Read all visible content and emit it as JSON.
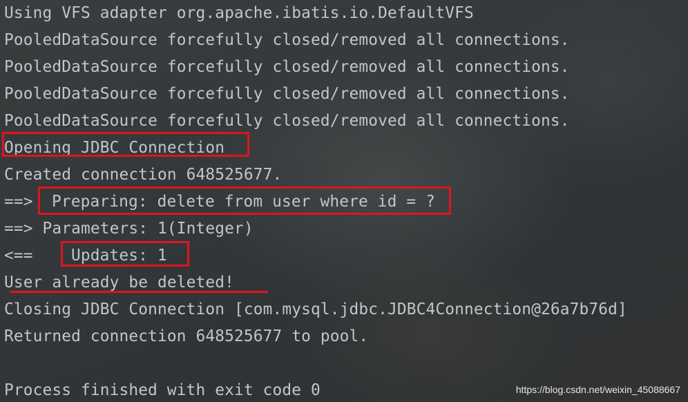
{
  "console": {
    "lines": [
      "Using VFS adapter org.apache.ibatis.io.DefaultVFS",
      "PooledDataSource forcefully closed/removed all connections.",
      "PooledDataSource forcefully closed/removed all connections.",
      "PooledDataSource forcefully closed/removed all connections.",
      "PooledDataSource forcefully closed/removed all connections.",
      "Opening JDBC Connection",
      "Created connection 648525677.",
      "==>",
      "==> Parameters: 1(Integer)",
      "<==",
      "User already be deleted!",
      "Closing JDBC Connection [com.mysql.jdbc.JDBC4Connection@26a7b76d]",
      "Returned connection 648525677 to pool.",
      "",
      "Process finished with exit code 0"
    ],
    "preparing_text": "Preparing: delete from user where id = ?",
    "updates_text": "Updates: 1"
  },
  "annotation_color": "#e0141e",
  "watermark": "https://blog.csdn.net/weixin_45088667"
}
